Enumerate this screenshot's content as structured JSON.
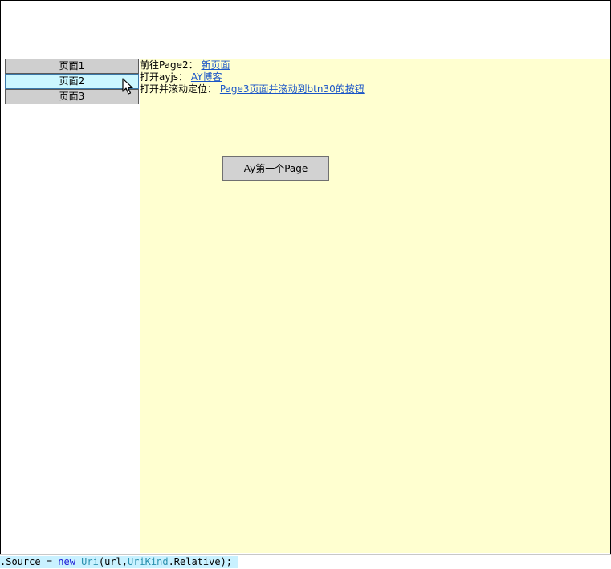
{
  "nav": {
    "items": [
      {
        "label": "页面1"
      },
      {
        "label": "页面2"
      },
      {
        "label": "页面3"
      }
    ]
  },
  "content": {
    "lines": [
      {
        "prefix": "前往Page2：",
        "link": "新页面"
      },
      {
        "prefix": "打开ayjs：",
        "link": "AY博客"
      },
      {
        "prefix": "打开并滚动定位：",
        "link": "Page3页面并滚动到btn30的按钮"
      }
    ],
    "button_label": "Ay第一个Page"
  },
  "code": {
    "part1": ".Source = ",
    "kw_new": "new",
    "space": " ",
    "type_uri": "Uri",
    "part2": "(url,",
    "type_urikind": "UriKind",
    "part3": ".Relative);"
  },
  "colors": {
    "content_bg": "#ffffd0",
    "nav_item_bg": "#cfcfcf",
    "nav_item_hover_bg": "#ccf7ff",
    "link": "#1a55c7",
    "code_highlight": "#c9f1ff"
  },
  "icons": {
    "cursor": "mouse-pointer-icon"
  }
}
